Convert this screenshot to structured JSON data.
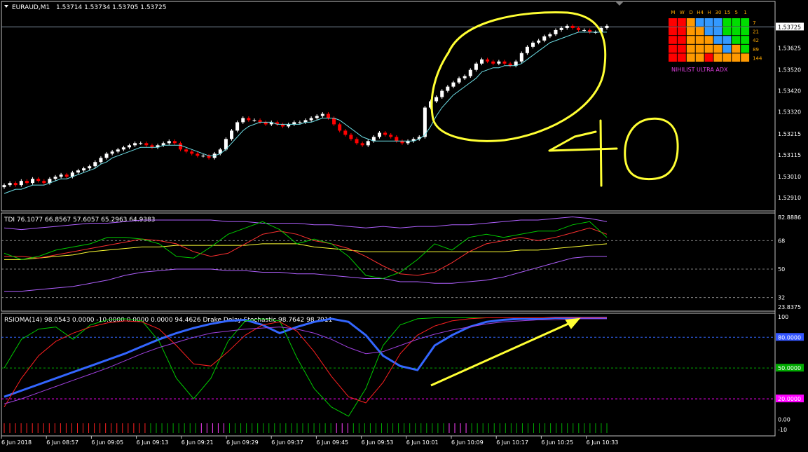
{
  "main_header": {
    "symbol_tf": "EURAUD,M1",
    "ohlc": "1.53714 1.53734 1.53705 1.53725"
  },
  "tdi_header": "TDI 76.1077 66.8567 57.6057 65.2963 64.9383",
  "rsioma_header": "RSIOMA(14) 98.0543 0.0000 -10.0000 0.0000 0.0000 94.4626  Drake Delay Stochastic 98.7642 98.7911",
  "adx_panel": {
    "timeframes": [
      "M",
      "W",
      "D",
      "H4",
      "H",
      "30",
      "15",
      "5",
      "1"
    ],
    "periods": [
      "7",
      "21",
      "42",
      "89",
      "144"
    ],
    "title": "NIHILIST ULTRA ADX",
    "colors": {
      "red": "#ff0000",
      "orange": "#ff9900",
      "blue": "#3399ff",
      "green": "#00dd00"
    },
    "grid": [
      [
        "red",
        "red",
        "orange",
        "blue",
        "blue",
        "blue",
        "green",
        "green",
        "green"
      ],
      [
        "red",
        "red",
        "orange",
        "orange",
        "blue",
        "blue",
        "green",
        "green",
        "green"
      ],
      [
        "red",
        "red",
        "orange",
        "orange",
        "orange",
        "blue",
        "blue",
        "green",
        "green"
      ],
      [
        "red",
        "red",
        "orange",
        "orange",
        "orange",
        "orange",
        "blue",
        "orange",
        "green"
      ],
      [
        "red",
        "red",
        "orange",
        "orange",
        "red",
        "orange",
        "orange",
        "orange",
        "orange"
      ]
    ]
  },
  "annotation_text": "40",
  "x_axis_labels": [
    "6 Jun 2018",
    "6 Jun 08:57",
    "6 Jun 09:05",
    "6 Jun 09:13",
    "6 Jun 09:21",
    "6 Jun 09:29",
    "6 Jun 09:37",
    "6 Jun 09:45",
    "6 Jun 09:53",
    "6 Jun 10:01",
    "6 Jun 10:09",
    "6 Jun 10:17",
    "6 Jun 10:25",
    "6 Jun 10:33"
  ],
  "colors": {
    "bull": "#ffffff",
    "bear": "#ff0000",
    "ma": "#6ee0e8",
    "annotation": "#ffff00",
    "grid": "#c0c0c0"
  },
  "chart_data": [
    {
      "type": "candlestick",
      "title": "EURAUD,M1",
      "ylim": [
        1.5285,
        1.538
      ],
      "y_ticks": [
        "1.53725",
        "1.53625",
        "1.53520",
        "1.53420",
        "1.53320",
        "1.53215",
        "1.53115",
        "1.53010",
        "1.52910"
      ],
      "current_price": "1.53725",
      "series_close": [
        1.5297,
        1.5298,
        1.5297,
        1.5299,
        1.5298,
        1.53,
        1.5299,
        1.5298,
        1.53,
        1.5301,
        1.5302,
        1.5301,
        1.5303,
        1.5304,
        1.5305,
        1.5306,
        1.5308,
        1.531,
        1.5312,
        1.5313,
        1.5314,
        1.5315,
        1.5316,
        1.5317,
        1.5317,
        1.5316,
        1.5315,
        1.5316,
        1.5317,
        1.5318,
        1.5317,
        1.5314,
        1.5313,
        1.5312,
        1.5311,
        1.5311,
        1.531,
        1.5312,
        1.5314,
        1.5319,
        1.5323,
        1.5327,
        1.5329,
        1.5328,
        1.5328,
        1.5327,
        1.5326,
        1.5327,
        1.5326,
        1.5325,
        1.5326,
        1.5327,
        1.5327,
        1.5328,
        1.5329,
        1.533,
        1.5331,
        1.5329,
        1.5326,
        1.5323,
        1.5321,
        1.5319,
        1.5317,
        1.5316,
        1.5318,
        1.532,
        1.5322,
        1.5321,
        1.532,
        1.5318,
        1.5317,
        1.5318,
        1.5319,
        1.532,
        1.5334,
        1.5337,
        1.5339,
        1.5342,
        1.5344,
        1.5346,
        1.5348,
        1.5349,
        1.5352,
        1.5355,
        1.5357,
        1.5356,
        1.5355,
        1.5356,
        1.5355,
        1.5354,
        1.5356,
        1.536,
        1.5363,
        1.5365,
        1.5366,
        1.5368,
        1.5369,
        1.5371,
        1.5372,
        1.5373,
        1.5372,
        1.5371,
        1.5371,
        1.537,
        1.537,
        1.5372,
        1.5373
      ],
      "series_ma": [
        1.5293,
        1.5294,
        1.5295,
        1.5295,
        1.5296,
        1.5297,
        1.5297,
        1.5297,
        1.5298,
        1.5299,
        1.53,
        1.53,
        1.5301,
        1.5302,
        1.5303,
        1.5304,
        1.5305,
        1.5307,
        1.5308,
        1.531,
        1.5311,
        1.5312,
        1.5313,
        1.5314,
        1.5315,
        1.5315,
        1.5315,
        1.5315,
        1.5316,
        1.5316,
        1.5316,
        1.5316,
        1.5315,
        1.5314,
        1.5313,
        1.5312,
        1.5311,
        1.5311,
        1.5312,
        1.5314,
        1.5317,
        1.532,
        1.5323,
        1.5325,
        1.5326,
        1.5327,
        1.5327,
        1.5327,
        1.5326,
        1.5326,
        1.5326,
        1.5326,
        1.5326,
        1.5327,
        1.5327,
        1.5328,
        1.5329,
        1.5329,
        1.5329,
        1.5328,
        1.5326,
        1.5324,
        1.5322,
        1.532,
        1.5319,
        1.5318,
        1.5318,
        1.5318,
        1.5318,
        1.5318,
        1.5318,
        1.5318,
        1.5318,
        1.5319,
        1.5321,
        1.5325,
        1.533,
        1.5334,
        1.5337,
        1.534,
        1.5342,
        1.5344,
        1.5346,
        1.5348,
        1.5351,
        1.5352,
        1.5353,
        1.5353,
        1.5354,
        1.5354,
        1.5354,
        1.5355,
        1.5357,
        1.5359,
        1.5361,
        1.5363,
        1.5365,
        1.5366,
        1.5367,
        1.5368,
        1.5369,
        1.537,
        1.537,
        1.537,
        1.537,
        1.537,
        1.537
      ]
    },
    {
      "type": "line",
      "title": "TDI",
      "ylim": [
        23.8375,
        85
      ],
      "y_ticks": [
        "82.8886",
        "68",
        "50",
        "32",
        "23.8375"
      ],
      "series": [
        {
          "color": "#b060ff",
          "values": [
            36,
            36,
            37,
            38,
            39,
            41,
            43,
            46,
            48,
            49,
            50,
            50,
            50,
            49,
            49,
            48,
            48,
            47,
            47,
            46,
            45,
            44,
            44,
            42,
            42,
            41,
            41,
            42,
            43,
            45,
            48,
            51,
            54,
            57,
            58,
            58
          ]
        },
        {
          "color": "#b060ff",
          "values": [
            76,
            75,
            76,
            77,
            78,
            79,
            79,
            80,
            81,
            81,
            81,
            81,
            81,
            80,
            80,
            79,
            79,
            79,
            78,
            78,
            77,
            76,
            77,
            76,
            77,
            77,
            78,
            78,
            79,
            80,
            81,
            81,
            82,
            83,
            82,
            80
          ]
        },
        {
          "color": "#ffff33",
          "values": [
            56,
            56,
            57,
            58,
            59,
            61,
            62,
            63,
            64,
            64,
            65,
            65,
            65,
            65,
            65,
            66,
            66,
            66,
            64,
            63,
            62,
            61,
            61,
            61,
            61,
            61,
            61,
            61,
            61,
            61,
            62,
            62,
            63,
            64,
            65,
            66
          ]
        },
        {
          "color": "#ff3030",
          "values": [
            58,
            58,
            57,
            59,
            61,
            63,
            65,
            67,
            69,
            68,
            66,
            61,
            58,
            60,
            66,
            72,
            74,
            72,
            68,
            66,
            63,
            58,
            52,
            47,
            46,
            48,
            54,
            61,
            66,
            68,
            70,
            68,
            70,
            73,
            76,
            72
          ]
        },
        {
          "color": "#00cc00",
          "values": [
            60,
            56,
            58,
            62,
            64,
            66,
            70,
            70,
            69,
            66,
            58,
            57,
            64,
            72,
            76,
            80,
            75,
            66,
            69,
            66,
            58,
            46,
            44,
            48,
            56,
            66,
            62,
            70,
            72,
            70,
            72,
            74,
            74,
            78,
            80,
            70
          ]
        }
      ]
    },
    {
      "type": "line",
      "title": "RSIOMA(14) / Drake Delay Stochastic",
      "ylim": [
        -10,
        100
      ],
      "y_ticks": [
        "100",
        "80.0000",
        "50.0000",
        "20.0000",
        "0.00",
        "-10"
      ],
      "series": [
        {
          "color": "#3366ff",
          "values": [
            22,
            28,
            34,
            40,
            46,
            52,
            58,
            64,
            71,
            78,
            84,
            89,
            93,
            96,
            97,
            92,
            84,
            90,
            95,
            98,
            95,
            82,
            62,
            52,
            48,
            72,
            82,
            90,
            95,
            97,
            98,
            98,
            99,
            99,
            99,
            99
          ]
        },
        {
          "color": "#00cc00",
          "values": [
            50,
            78,
            88,
            90,
            78,
            92,
            97,
            98,
            96,
            76,
            40,
            20,
            40,
            76,
            96,
            98,
            96,
            60,
            30,
            12,
            3,
            30,
            72,
            92,
            98,
            99,
            99,
            99,
            99,
            99,
            99,
            99,
            99,
            99,
            99,
            99
          ]
        },
        {
          "color": "#ff2020",
          "values": [
            12,
            40,
            62,
            76,
            84,
            90,
            94,
            96,
            95,
            88,
            72,
            54,
            52,
            66,
            82,
            92,
            95,
            86,
            66,
            42,
            22,
            16,
            36,
            64,
            82,
            91,
            96,
            98,
            99,
            99,
            99,
            99,
            99,
            99,
            99,
            99
          ]
        },
        {
          "color": "#a040e0",
          "values": [
            15,
            20,
            26,
            32,
            38,
            44,
            50,
            57,
            64,
            70,
            75,
            80,
            84,
            86,
            88,
            89,
            90,
            88,
            84,
            78,
            70,
            64,
            66,
            72,
            78,
            83,
            87,
            90,
            93,
            95,
            96,
            97,
            97,
            98,
            98,
            98
          ]
        }
      ]
    }
  ]
}
